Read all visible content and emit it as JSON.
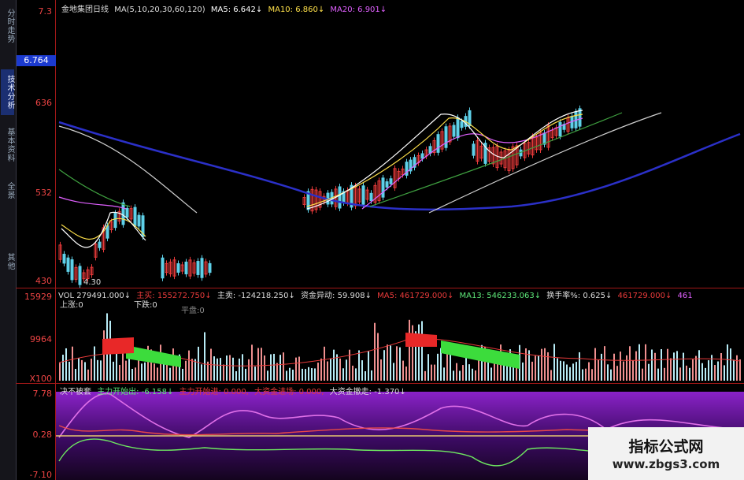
{
  "sidebar": {
    "tabs": [
      {
        "label": "分时走势",
        "active": false
      },
      {
        "label": "技术分析",
        "active": true
      },
      {
        "label": "基本资料",
        "active": false
      },
      {
        "label": "全景",
        "active": false
      },
      {
        "label": "其他",
        "active": false
      }
    ]
  },
  "price_axis": {
    "top_label": "7.3",
    "current_price": "6.764",
    "labels": [
      "636",
      "532",
      "430"
    ]
  },
  "kline_header": {
    "stock_name": "金地集团",
    "period": "日线",
    "ma_params": "MA(5,10,20,30,60,120)",
    "ma5": "MA5: 6.642↓",
    "ma10": "MA10: 6.860↓",
    "ma20": "MA20: 6.901↓"
  },
  "kline_annotation": "4.30",
  "volume_header": {
    "vol": "VOL 279491.000↓",
    "main_buy": "主买: 155272.750↓",
    "main_sell": "主卖: -124218.250↓",
    "fund_change": "资金异动: 59.908↓",
    "ma5": "MA5: 461729.000↓",
    "ma13": "MA13: 546233.063↓",
    "turnover": "换手率%: 0.625↓",
    "extra1": "461729.000↓",
    "extra2": "461",
    "sub1": "上涨:0",
    "sub2": "下跌:0",
    "sub3": "平盘:0"
  },
  "volume_axis": {
    "labels": [
      "15929",
      "9964",
      "X100"
    ]
  },
  "indicator_header": {
    "name": "决不被套",
    "main_in": "主力开始出: -6.158↓",
    "main_start": "主力开始进: 0.000,",
    "big_in": "大资金进场: 0.000,",
    "big_out": "大资金撤走: -1.370↓"
  },
  "indicator_axis": {
    "labels": [
      "7.78",
      "0.28",
      "-7.10"
    ]
  },
  "colors": {
    "up": "#e83a3a",
    "down": "#5ed0e8",
    "ma5": "#ffffff",
    "ma10": "#ffe14a",
    "ma20": "#e060ff",
    "grid_red": "#a01818",
    "purple_bg": "#7a1ab0"
  },
  "watermark": {
    "line1": "指标公式网",
    "line2": "www.zbgs3.com"
  }
}
